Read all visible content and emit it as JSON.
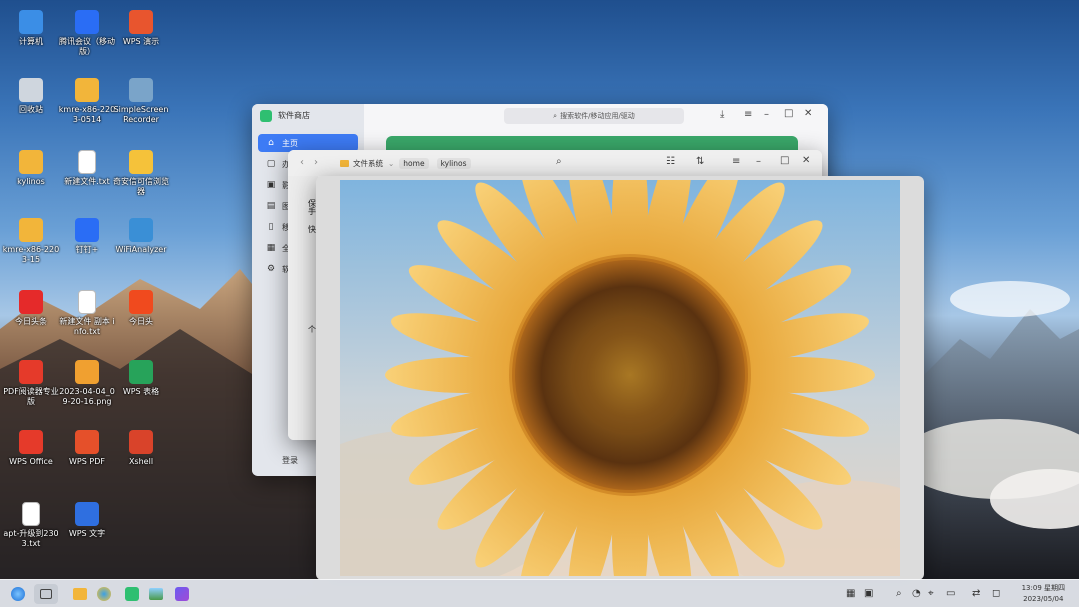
{
  "desktop": {
    "icons": [
      {
        "label": "计算机",
        "icon": "computer-icon",
        "color": "#3b8ee6"
      },
      {
        "label": "腾讯会议（移动版）",
        "icon": "tencent-meeting-icon",
        "color": "#2a6df5"
      },
      {
        "label": "WPS 演示",
        "icon": "wps-presentation-icon",
        "color": "#e8552e"
      },
      {
        "label": "回收站",
        "icon": "trash-icon",
        "color": "#cfd6de"
      },
      {
        "label": "kmre-x86-2203-0514",
        "icon": "folder-icon",
        "color": "#f2b53a"
      },
      {
        "label": "SimpleScreen Recorder",
        "icon": "screen-recorder-icon",
        "color": "#7aa4c9"
      },
      {
        "label": "kylinos",
        "icon": "folder-icon",
        "color": "#f2b53a"
      },
      {
        "label": "新建文件.txt",
        "icon": "text-file-icon",
        "color": "#ffffff"
      },
      {
        "label": "奇安信可信浏览器",
        "icon": "browser-icon",
        "color": "#f5c23a"
      },
      {
        "label": "kmre-x86-2203-15",
        "icon": "folder-icon",
        "color": "#f2b53a"
      },
      {
        "label": "钉钉+",
        "icon": "dingtalk-icon",
        "color": "#2a6df5"
      },
      {
        "label": "WiFiAnalyzer",
        "icon": "wifi-analyzer-icon",
        "color": "#3a8fd6"
      },
      {
        "label": "今日头条",
        "icon": "toutiao-icon",
        "color": "#e52a2a"
      },
      {
        "label": "新建文件 副本 info.txt",
        "icon": "text-file-icon",
        "color": "#ffffff"
      },
      {
        "label": "今日头",
        "icon": "toutiao-app-icon",
        "color": "#f04a1e"
      },
      {
        "label": "PDF阅读器专业版",
        "icon": "pdf-reader-icon",
        "color": "#e53a2a"
      },
      {
        "label": "2023-04-04_09-20-16.png",
        "icon": "image-file-icon",
        "color": "#f0a030"
      },
      {
        "label": "WPS 表格",
        "icon": "wps-spreadsheet-icon",
        "color": "#27a35a"
      },
      {
        "label": "WPS Office",
        "icon": "wps-office-icon",
        "color": "#e53a2a"
      },
      {
        "label": "WPS PDF",
        "icon": "wps-pdf-icon",
        "color": "#e5502a"
      },
      {
        "label": "Xshell",
        "icon": "xshell-icon",
        "color": "#d9432a"
      },
      {
        "label": "apt-升级到2303.txt",
        "icon": "text-file-icon",
        "color": "#ffffff"
      },
      {
        "label": "WPS 文字",
        "icon": "wps-writer-icon",
        "color": "#2f6fe0"
      }
    ]
  },
  "store_window": {
    "title": "软件商店",
    "search_placeholder": "搜索软件/移动应用/驱动",
    "sidebar": [
      {
        "label": "主页",
        "icon": "home-icon",
        "active": true
      },
      {
        "label": "办",
        "icon": "office-icon",
        "active": false
      },
      {
        "label": "影",
        "icon": "video-icon",
        "active": false
      },
      {
        "label": "图",
        "icon": "image-icon",
        "active": false
      },
      {
        "label": "移",
        "icon": "mobile-icon",
        "active": false
      },
      {
        "label": "全",
        "icon": "grid-icon",
        "active": false
      },
      {
        "label": "软",
        "icon": "settings-icon",
        "active": false
      }
    ],
    "bottom_label": "登录",
    "accent": "#3d7bf5",
    "banner_color": "#3aa86a"
  },
  "files_window": {
    "path": [
      "文件系统",
      "home",
      "kylinos"
    ],
    "side_labels": [
      "保",
      "手",
      "快",
      "个"
    ]
  },
  "viewer_window": {
    "image_subject": "sunflower"
  },
  "taskbar": {
    "apps": [
      {
        "icon": "start-menu-icon"
      },
      {
        "icon": "multitask-view-icon"
      },
      {
        "icon": "file-manager-icon"
      },
      {
        "icon": "browser-icon"
      },
      {
        "icon": "software-store-icon"
      },
      {
        "icon": "image-viewer-icon"
      },
      {
        "icon": "screen-recorder-icon"
      }
    ],
    "tray": [
      "keyboard-icon",
      "tablet-mode-icon",
      "search-icon",
      "nosound-icon",
      "network-icon",
      "battery-icon",
      "bluetooth-icon",
      "notification-icon"
    ],
    "time": "13:09 星期四",
    "date": "2023/05/04"
  }
}
